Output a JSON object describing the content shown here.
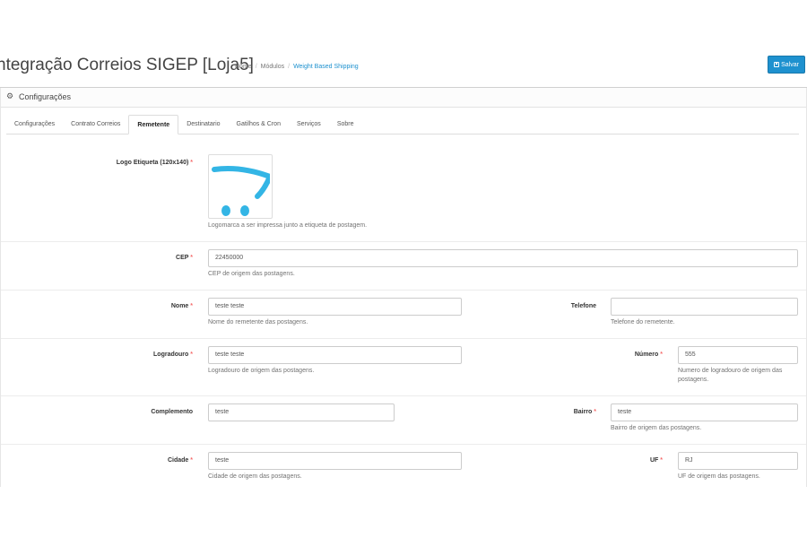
{
  "header": {
    "title": "ntegração Correios SIGEP [Loja5]",
    "breadcrumb": [
      "Home",
      "Módulos",
      "Weight Based Shipping"
    ],
    "save_label": "Salvar"
  },
  "panel": {
    "title": "Configurações",
    "icon": "gear-icon"
  },
  "tabs": [
    {
      "label": "Configurações",
      "active": false
    },
    {
      "label": "Contrato Correios",
      "active": false
    },
    {
      "label": "Remetente",
      "active": true
    },
    {
      "label": "Destinatario",
      "active": false
    },
    {
      "label": "Gatilhos & Cron",
      "active": false
    },
    {
      "label": "Serviços",
      "active": false
    },
    {
      "label": "Sobre",
      "active": false
    }
  ],
  "form": {
    "logo": {
      "label": "Logo Etiqueta (120x140)",
      "help": "Logomarca a ser impressa junto a etiqueta de postagem."
    },
    "cep": {
      "label": "CEP",
      "value": "22450000",
      "help": "CEP de origem das postagens."
    },
    "nome": {
      "label": "Nome",
      "value": "teste teste",
      "help": "Nome do remetente das postagens."
    },
    "telefone": {
      "label": "Telefone",
      "value": "",
      "help": "Telefone do remetente."
    },
    "logradouro": {
      "label": "Logradouro",
      "value": "teste teste",
      "help": "Logradouro de origem das postagens."
    },
    "numero": {
      "label": "Número",
      "value": "555",
      "help1": "Numero de logradouro de origem das",
      "help2": "postagens."
    },
    "complemento": {
      "label": "Complemento",
      "value": "teste"
    },
    "bairro": {
      "label": "Bairro",
      "value": "teste",
      "help": "Bairro de origem das postagens."
    },
    "cidade": {
      "label": "Cidade",
      "value": "teste",
      "help": "Cidade de origem das postagens."
    },
    "uf": {
      "label": "UF",
      "value": "RJ",
      "help": "UF de origem das postagens."
    },
    "required_mark": "*"
  },
  "colors": {
    "accent": "#1e91cf",
    "required": "#f56b6b",
    "logo_cart": "#33b5e5"
  }
}
